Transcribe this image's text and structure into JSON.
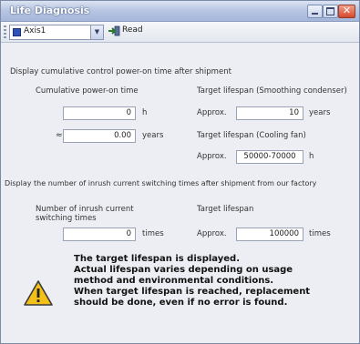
{
  "window": {
    "title": "Life Diagnosis"
  },
  "toolbar": {
    "axis_value": "Axis1",
    "read_label": "Read"
  },
  "power_on": {
    "section_label": "Display cumulative control power-on time after shipment",
    "cumulative_label": "Cumulative power-on time",
    "hours_value": "0",
    "hours_unit": "h",
    "approx_symbol": "≈",
    "years_value": "0.00",
    "years_unit": "years",
    "target_condenser_label": "Target lifespan (Smoothing condenser)",
    "approx_label_1": "Approx.",
    "condenser_value": "10",
    "condenser_unit": "years",
    "target_fan_label": "Target lifespan (Cooling fan)",
    "approx_label_2": "Approx.",
    "fan_value": "50000-70000",
    "fan_unit": "h"
  },
  "inrush": {
    "section_label": "Display the number of inrush current switching times after shipment from our factory",
    "count_label_line1": "Number of inrush current",
    "count_label_line2": "switching times",
    "count_value": "0",
    "count_unit": "times",
    "target_label": "Target lifespan",
    "approx_label": "Approx.",
    "target_value": "100000",
    "target_unit": "times"
  },
  "warning": {
    "icon": "warning-triangle-icon",
    "lines": [
      "The target lifespan is displayed.",
      "Actual lifespan varies depending on usage",
      "method and environmental conditions.",
      "When target lifespan is reached, replacement",
      "should be done, even if no error is found."
    ]
  },
  "colors": {
    "title_bar": "#a4b6da",
    "warning_fill": "#f2c019",
    "axis_icon": "#2d52b8"
  }
}
